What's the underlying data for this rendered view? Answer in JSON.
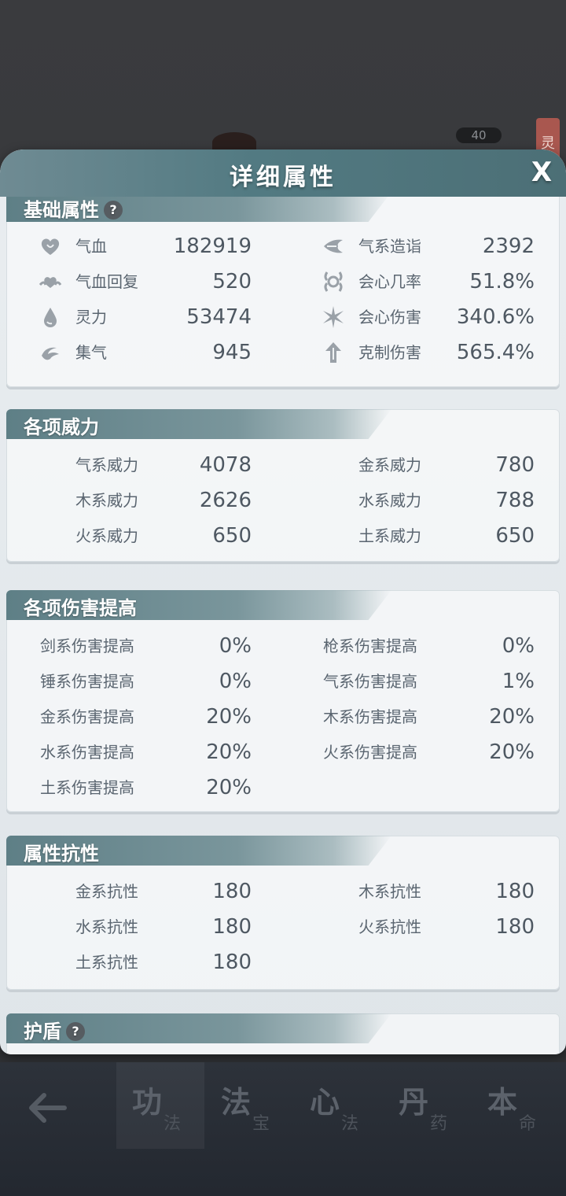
{
  "background": {
    "level": "40",
    "seal": "灵"
  },
  "panel": {
    "title": "详细属性",
    "close_label": "X"
  },
  "sections": {
    "basic": {
      "title": "基础属性",
      "left": [
        {
          "icon": "heart-icon",
          "label": "气血",
          "value": "182919"
        },
        {
          "icon": "heart-regen-icon",
          "label": "气血回复",
          "value": "520"
        },
        {
          "icon": "water-drop-icon",
          "label": "灵力",
          "value": "53474"
        },
        {
          "icon": "swirl-icon",
          "label": "集气",
          "value": "945"
        }
      ],
      "right": [
        {
          "icon": "qi-blast-icon",
          "label": "气系造诣",
          "value": "2392"
        },
        {
          "icon": "crit-rate-icon",
          "label": "会心几率",
          "value": "51.8%"
        },
        {
          "icon": "starburst-icon",
          "label": "会心伤害",
          "value": "340.6%"
        },
        {
          "icon": "arrow-up-icon",
          "label": "克制伤害",
          "value": "565.4%"
        }
      ]
    },
    "power": {
      "title": "各项威力",
      "left": [
        {
          "label": "气系威力",
          "value": "4078"
        },
        {
          "label": "木系威力",
          "value": "2626"
        },
        {
          "label": "火系威力",
          "value": "650"
        }
      ],
      "right": [
        {
          "label": "金系威力",
          "value": "780"
        },
        {
          "label": "水系威力",
          "value": "788"
        },
        {
          "label": "土系威力",
          "value": "650"
        }
      ]
    },
    "damage": {
      "title": "各项伤害提高",
      "left": [
        {
          "label": "剑系伤害提高",
          "value": "0%"
        },
        {
          "label": "锤系伤害提高",
          "value": "0%"
        },
        {
          "label": "金系伤害提高",
          "value": "20%"
        },
        {
          "label": "水系伤害提高",
          "value": "20%"
        },
        {
          "label": "土系伤害提高",
          "value": "20%"
        }
      ],
      "right": [
        {
          "label": "枪系伤害提高",
          "value": "0%"
        },
        {
          "label": "气系伤害提高",
          "value": "1%"
        },
        {
          "label": "木系伤害提高",
          "value": "20%"
        },
        {
          "label": "火系伤害提高",
          "value": "20%"
        }
      ]
    },
    "resist": {
      "title": "属性抗性",
      "left": [
        {
          "label": "金系抗性",
          "value": "180"
        },
        {
          "label": "水系抗性",
          "value": "180"
        },
        {
          "label": "土系抗性",
          "value": "180"
        }
      ],
      "right": [
        {
          "label": "木系抗性",
          "value": "180"
        },
        {
          "label": "火系抗性",
          "value": "180"
        }
      ]
    },
    "shield": {
      "title": "护盾"
    }
  },
  "help_label": "?",
  "bottom_nav": {
    "back_icon": "arrow-left-icon",
    "tabs": [
      {
        "main": "功",
        "sub": "法"
      },
      {
        "main": "法",
        "sub": "宝"
      },
      {
        "main": "心",
        "sub": "法"
      },
      {
        "main": "丹",
        "sub": "药"
      },
      {
        "main": "本",
        "sub": "命"
      }
    ],
    "active_index": 0
  },
  "colors": {
    "header": "#527a82",
    "panel_bg": "#e6ebee",
    "text": "#4e5862",
    "nav_bg": "#272c34"
  }
}
